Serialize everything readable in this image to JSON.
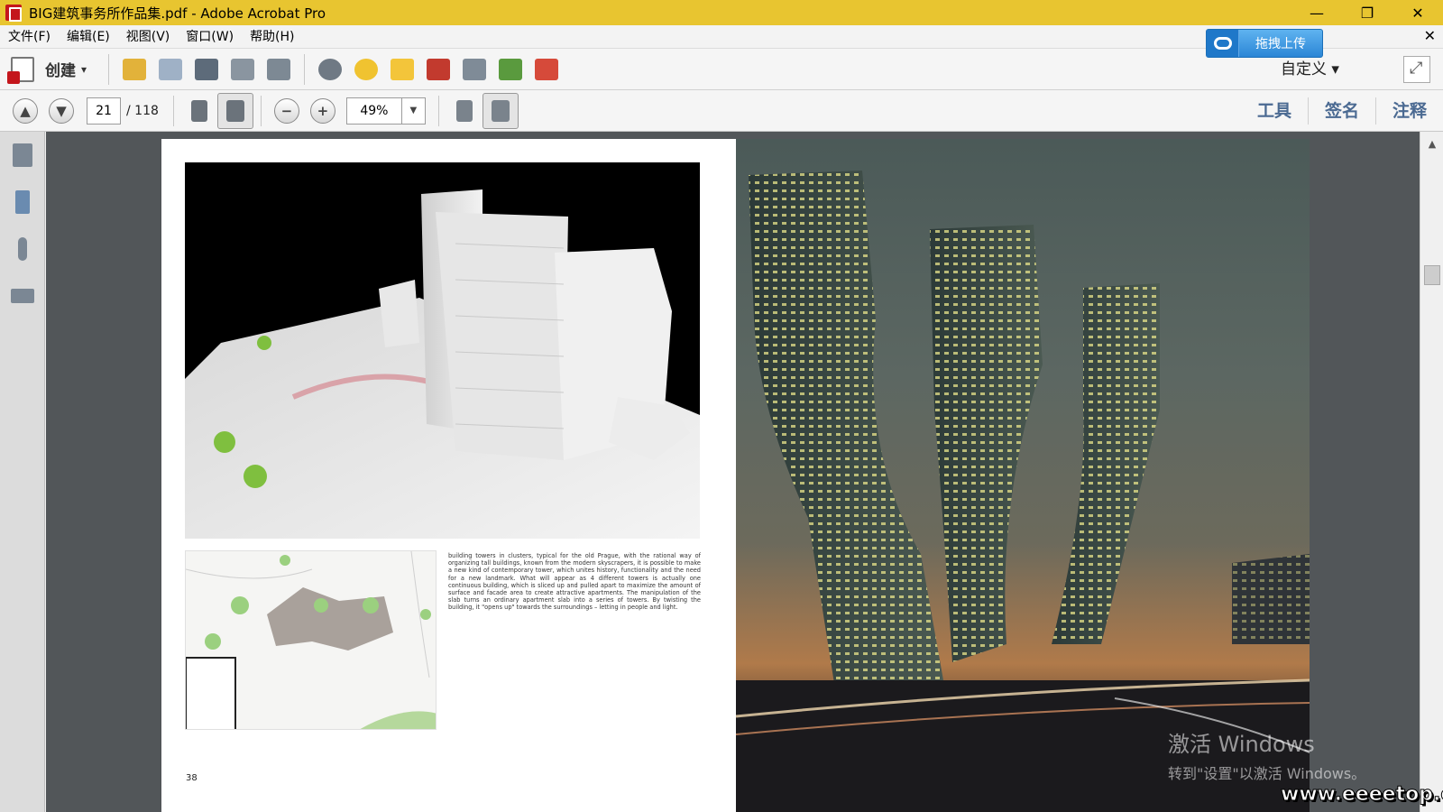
{
  "window": {
    "title": "BIG建筑事务所作品集.pdf - Adobe Acrobat Pro",
    "minimize": "—",
    "restore": "❐",
    "close": "✕"
  },
  "menu": {
    "items": [
      "文件(F)",
      "编辑(E)",
      "视图(V)",
      "窗口(W)",
      "帮助(H)"
    ],
    "close_doc": "✕"
  },
  "upload": {
    "label": "拖拽上传"
  },
  "toolbar1": {
    "create_label": "创建",
    "create_arrow": "▾",
    "customize_label": "自定义 ▾",
    "colors": {
      "open": "#e2b23a",
      "save": "#9fb1c6",
      "print": "#5d6b7a",
      "edit": "#8a95a0",
      "mail": "#7d8994",
      "settings": "#6f7984",
      "comment": "#f0c330",
      "highlight": "#f3c53a",
      "redact": "#c23a2e",
      "compare": "#7f8b97",
      "export": "#5a9a3e",
      "sign": "#d64a3a"
    }
  },
  "toolbar2": {
    "prev_icon": "▲",
    "next_icon": "▼",
    "page_current": "21",
    "page_total": "/ 118",
    "zoom_out_icon": "−",
    "zoom_in_icon": "+",
    "zoom_value": "49%",
    "zoom_arrow": "▼",
    "right_links": [
      "工具",
      "签名",
      "注释"
    ]
  },
  "left_panel": {
    "icons": [
      "pages-icon",
      "bookmark-icon",
      "attachment-icon",
      "signature-icon"
    ]
  },
  "document": {
    "left_page": {
      "body_text": "building towers in clusters, typical for the old Prague, with the rational way of organizing tall buildings, known from the modern skyscrapers, it is possible to make a new kind of contemporary tower, which unites history, functionality and the need for a new landmark. What will appear as 4 different towers is actually one continuous building, which is sliced up and pulled apart to maximize the amount of surface and facade area to create attractive apartments. The manipulation of the slab turns an ordinary apartment slab into a series of towers. By twisting the building, it \"opens up\" towards the surroundings – letting in people and light.",
      "page_number": "38"
    }
  },
  "scrollbar": {
    "up_icon": "▲"
  },
  "watermark": {
    "activate_line1": "激活 Windows",
    "activate_line2": "转到\"设置\"以激活 Windows。",
    "site": "www.eeeetop.com"
  }
}
